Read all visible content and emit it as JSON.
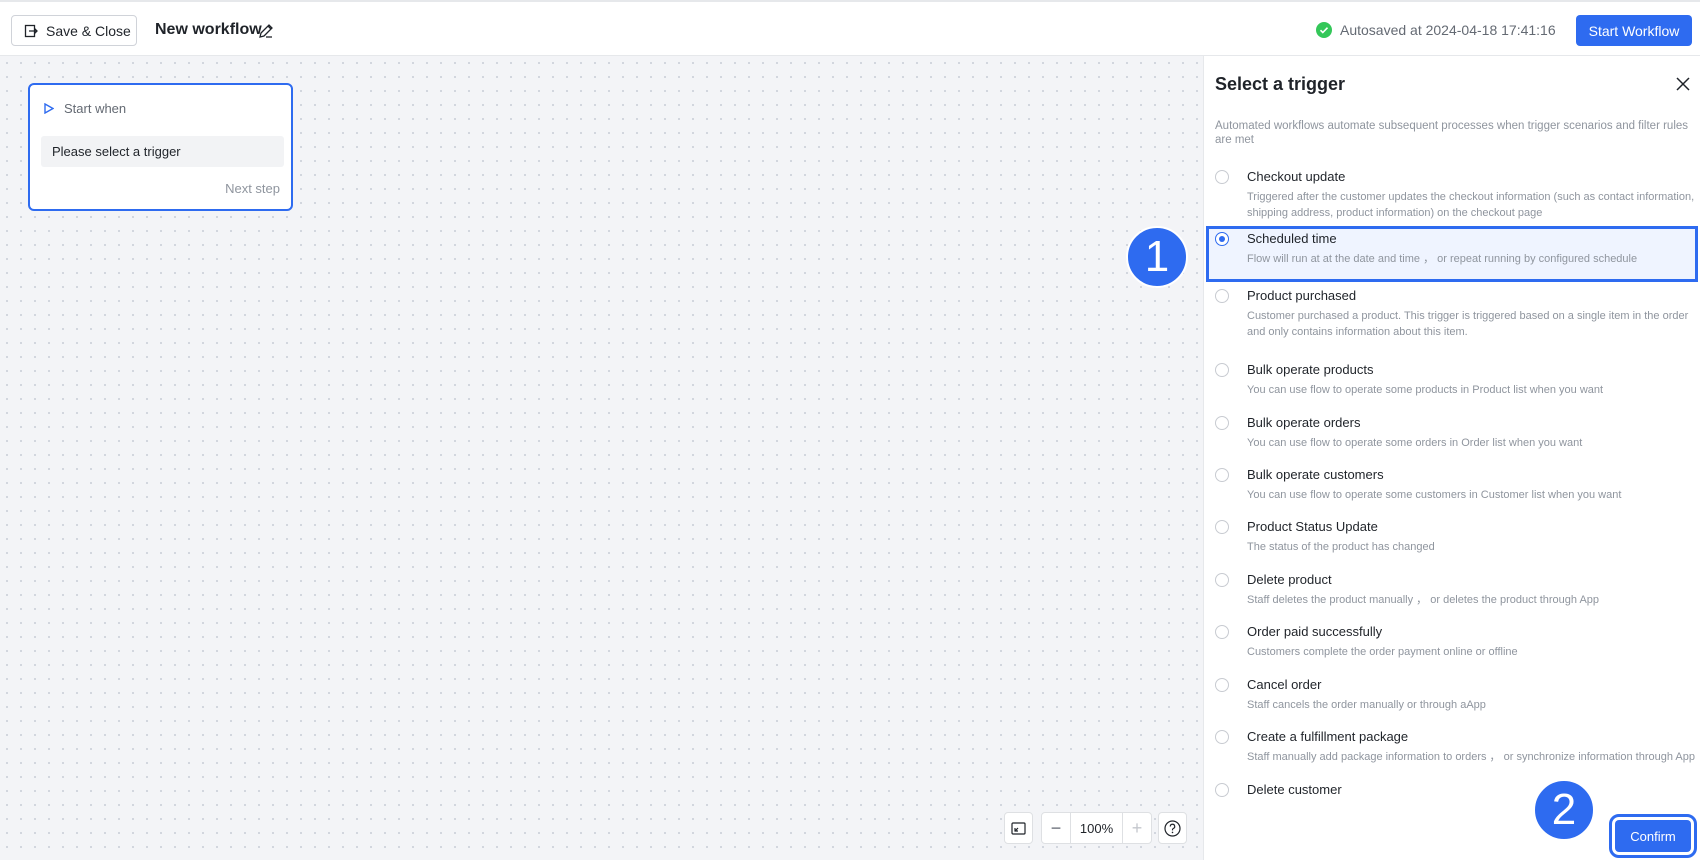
{
  "header": {
    "save_close_label": "Save & Close",
    "workflow_title": "New workflow",
    "autosave_text": "Autosaved at 2024-04-18 17:41:16",
    "start_button_label": "Start Workflow"
  },
  "canvas": {
    "node": {
      "head_label": "Start when",
      "trigger_placeholder": "Please select a trigger",
      "next_step_label": "Next step"
    },
    "zoom": {
      "value": "100%",
      "minus": "−",
      "plus": "+"
    }
  },
  "panel": {
    "title": "Select a trigger",
    "description": "Automated workflows automate subsequent processes when trigger scenarios and filter rules are met",
    "selected_index": 1,
    "triggers": [
      {
        "name": "Checkout update",
        "desc": "Triggered after the customer updates the checkout information (such as contact information, shipping address, product information) on the checkout page"
      },
      {
        "name": "Scheduled time",
        "desc": "Flow will run at at the date and time ，  or repeat running by configured schedule"
      },
      {
        "name": "Product purchased",
        "desc": "Customer purchased a product. This trigger is triggered based on a single item in the order and only contains information about this item."
      },
      {
        "name": "Bulk operate products",
        "desc": "You can use flow to operate some products in Product list when you want"
      },
      {
        "name": "Bulk operate orders",
        "desc": "You can use flow to operate some orders in Order list when you want"
      },
      {
        "name": "Bulk operate customers",
        "desc": "You can use flow to operate some customers in Customer list when you want"
      },
      {
        "name": "Product Status Update",
        "desc": "The status of the product has changed"
      },
      {
        "name": "Delete product",
        "desc": "Staff deletes the product manually ，  or deletes the product through App"
      },
      {
        "name": "Order paid successfully",
        "desc": "Customers complete the order payment online or offline"
      },
      {
        "name": "Cancel order",
        "desc": "Staff cancels the order manually or through aApp"
      },
      {
        "name": "Create a fulfillment package",
        "desc": "Staff manually add package information to orders ，  or synchronize information through App"
      },
      {
        "name": "Delete customer",
        "desc": ""
      }
    ],
    "confirm_label": "Confirm"
  },
  "markers": {
    "step1": "1",
    "step2": "2"
  }
}
